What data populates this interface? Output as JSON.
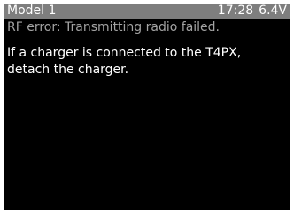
{
  "status_bar": {
    "model_name": "Model 1",
    "time": "17:28",
    "voltage": "6.4V"
  },
  "error": {
    "text": "RF error: Transmitting radio failed."
  },
  "message": {
    "lines": [
      "If a charger is connected to the T4PX,",
      "detach the charger."
    ]
  },
  "colors": {
    "screen_background": "#000000",
    "status_bar_background": "#7e7e7e",
    "status_text": "#ffffff",
    "error_text": "#a3a3a3",
    "message_text": "#ffffff",
    "frame_background": "#ffffff"
  }
}
